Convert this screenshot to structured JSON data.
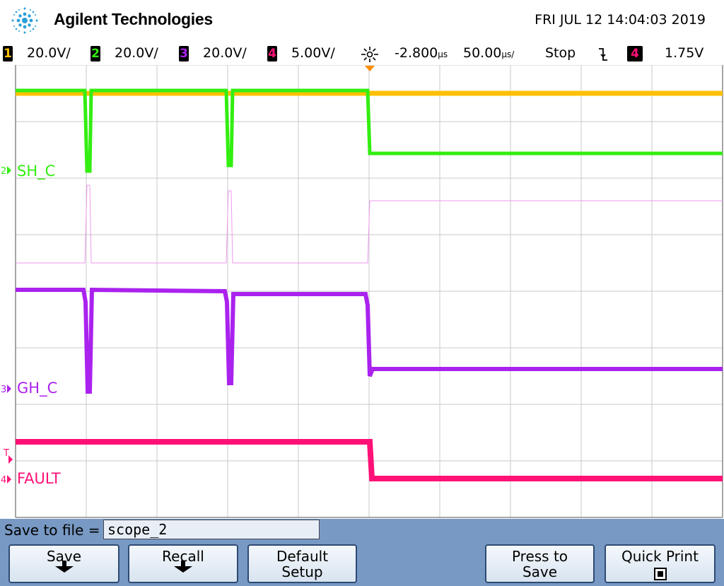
{
  "header": {
    "brand": "Agilent Technologies",
    "datetime": "FRI JUL 12 14:04:03 2019"
  },
  "status_bar": {
    "channels": [
      {
        "num": "1",
        "scale": "20.0V/",
        "color": "#ffc000"
      },
      {
        "num": "2",
        "scale": "20.0V/",
        "color": "#33ee11"
      },
      {
        "num": "3",
        "scale": "20.0V/",
        "color": "#aa22ee"
      },
      {
        "num": "4",
        "scale": "5.00V/",
        "color": "#ff1177"
      }
    ],
    "delay": "-2.800",
    "delay_unit": "µs",
    "timebase": "50.00",
    "timebase_unit": "µs/",
    "run_state": "Stop",
    "trigger_channel": "4",
    "trigger_level": "1.75V"
  },
  "traces": {
    "ch2": {
      "num": "2",
      "label": "SH_C",
      "color": "#33ee11"
    },
    "ch3": {
      "num": "3",
      "label": "GH_C",
      "color": "#aa22ee"
    },
    "ch4": {
      "num": "4",
      "label": "FAULT",
      "color": "#ff1177"
    },
    "ch1_color": "#ffc000",
    "math_color": "#ee99ee",
    "trigger_marker": "T"
  },
  "save_panel": {
    "label": "Save to file =",
    "filename": "scope_2",
    "softkeys": {
      "save": "Save",
      "recall": "Recall",
      "default_setup_line1": "Default",
      "default_setup_line2": "Setup",
      "press_to_save_line1": "Press to",
      "press_to_save_line2": "Save",
      "quick_print": "Quick Print"
    }
  }
}
